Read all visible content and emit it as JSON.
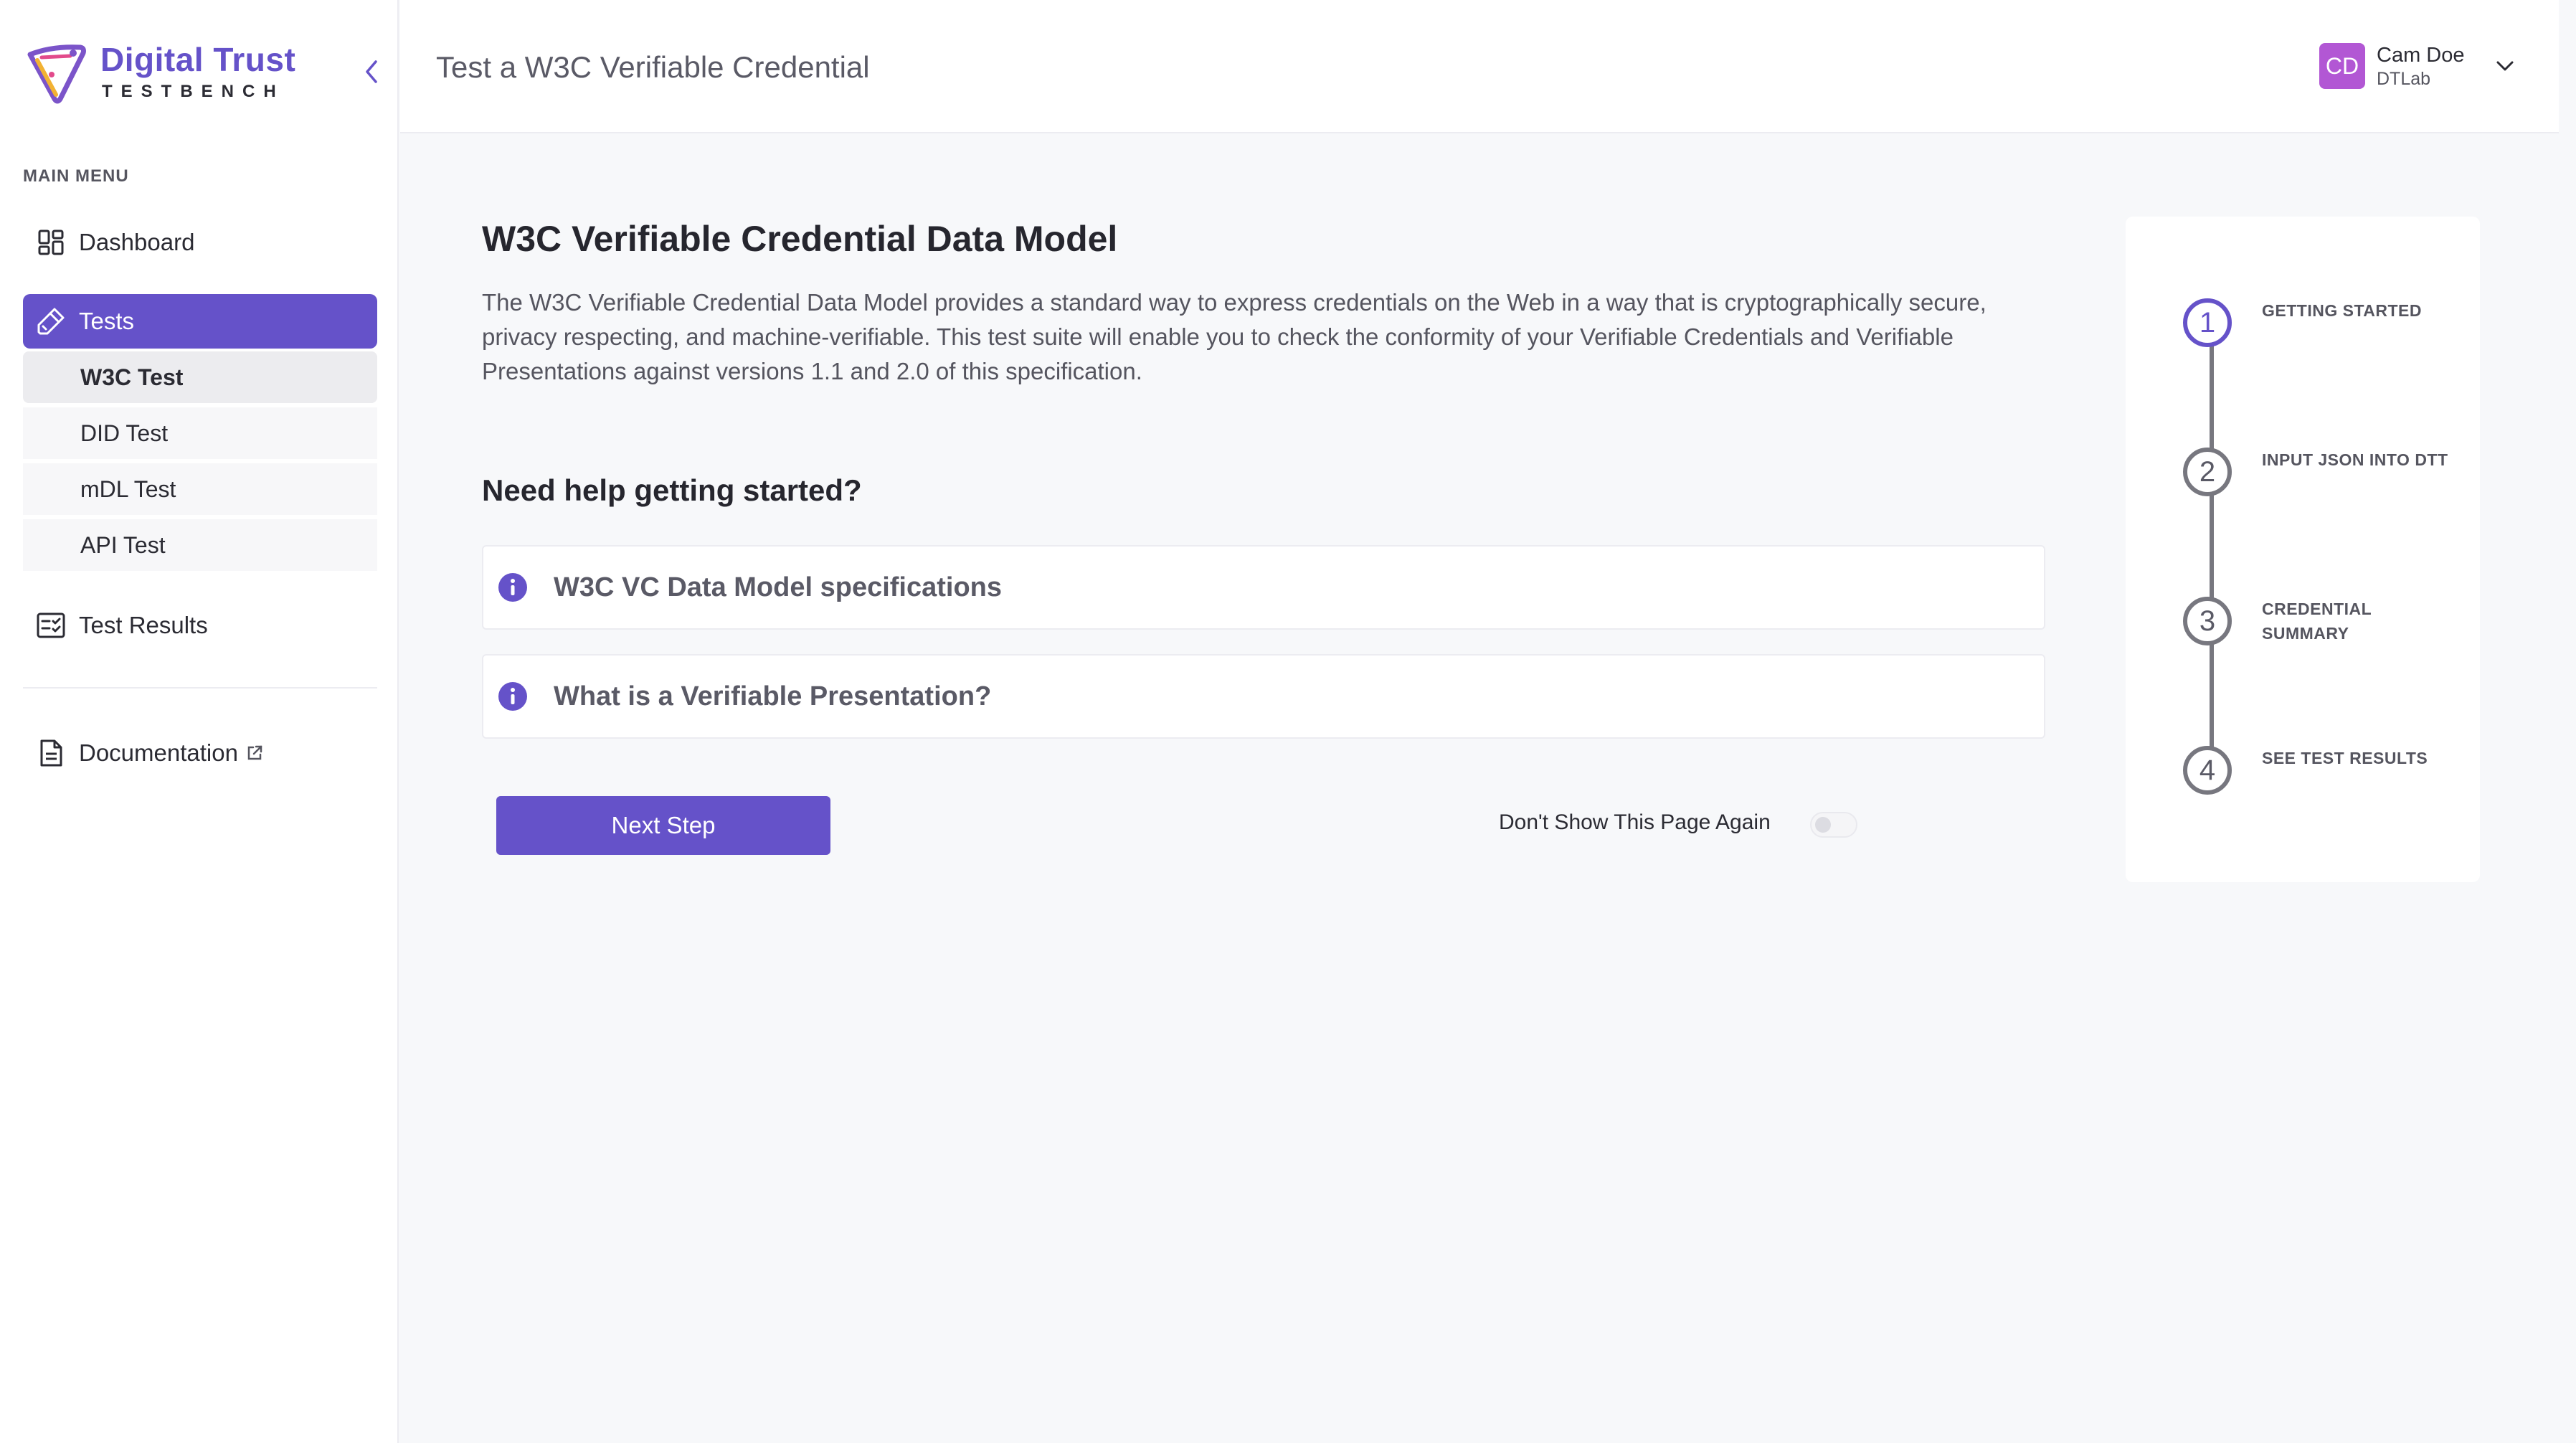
{
  "brand": {
    "title": "Digital Trust",
    "subtitle": "TESTBENCH"
  },
  "colors": {
    "accent": "#6552c9",
    "avatar": "#b257d4"
  },
  "sidebar": {
    "menu_label": "MAIN MENU",
    "items": [
      {
        "label": "Dashboard",
        "icon": "dashboard-icon"
      },
      {
        "label": "Tests",
        "icon": "tests-icon",
        "active": true
      },
      {
        "label": "Test Results",
        "icon": "test-results-icon"
      },
      {
        "label": "Documentation",
        "icon": "document-icon",
        "external": true
      }
    ],
    "sub_items": [
      {
        "label": "W3C Test",
        "selected": true
      },
      {
        "label": "DID Test"
      },
      {
        "label": "mDL Test"
      },
      {
        "label": "API Test"
      }
    ]
  },
  "header": {
    "title": "Test a W3C Verifiable Credential",
    "user": {
      "initials": "CD",
      "name": "Cam Doe",
      "org": "DTLab"
    }
  },
  "main": {
    "heading": "W3C Verifiable Credential Data Model",
    "description": "The W3C Verifiable Credential Data Model provides a standard way to express credentials on the Web in a way that is cryptographically secure, privacy respecting, and machine-verifiable. This test suite will enable you to check the conformity of your Verifiable Credentials and Verifiable Presentations against versions 1.1 and 2.0 of this specification.",
    "help_heading": "Need help getting started?",
    "accordions": [
      {
        "title": "W3C VC Data Model specifications"
      },
      {
        "title": "What is a Verifiable Presentation?"
      }
    ],
    "next_button": "Next Step",
    "dont_show_label": "Don't Show This Page Again",
    "dont_show_enabled": false
  },
  "stepper": {
    "steps": [
      {
        "number": "1",
        "label": "GETTING STARTED",
        "active": true
      },
      {
        "number": "2",
        "label": "INPUT JSON INTO DTT"
      },
      {
        "number": "3",
        "label": "CREDENTIAL SUMMARY"
      },
      {
        "number": "4",
        "label": "SEE TEST RESULTS"
      }
    ]
  }
}
